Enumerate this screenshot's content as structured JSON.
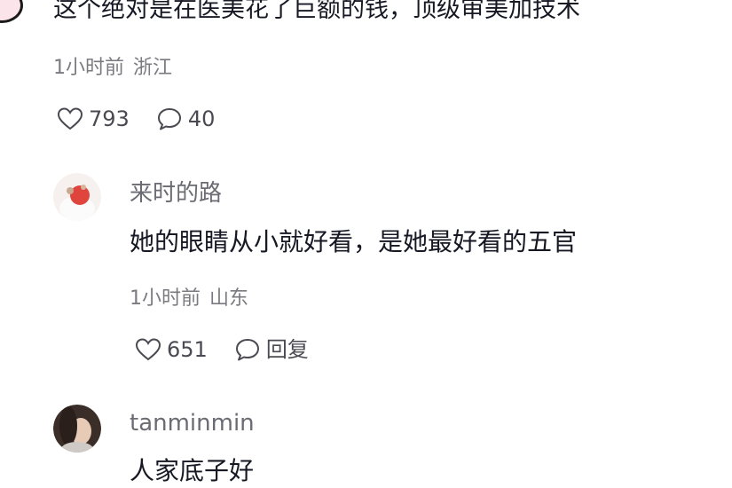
{
  "comment_top": {
    "text": "这个绝对是在医美花了巨额的钱，顶级审美加技术",
    "time": "1小时前",
    "location": "浙江",
    "likes": "793",
    "replies": "40"
  },
  "replies": [
    {
      "username": "来时的路",
      "text": "她的眼睛从小就好看，是她最好看的五官",
      "time": "1小时前",
      "location": "山东",
      "likes": "651",
      "reply_label": "回复"
    },
    {
      "username": "tanminmin",
      "text": "人家底子好"
    }
  ],
  "icons": [
    "heart-icon",
    "comment-bubble-icon"
  ],
  "colors": {
    "text": "#161823",
    "meta": "#7a7a80",
    "icon": "#4a4a52"
  }
}
